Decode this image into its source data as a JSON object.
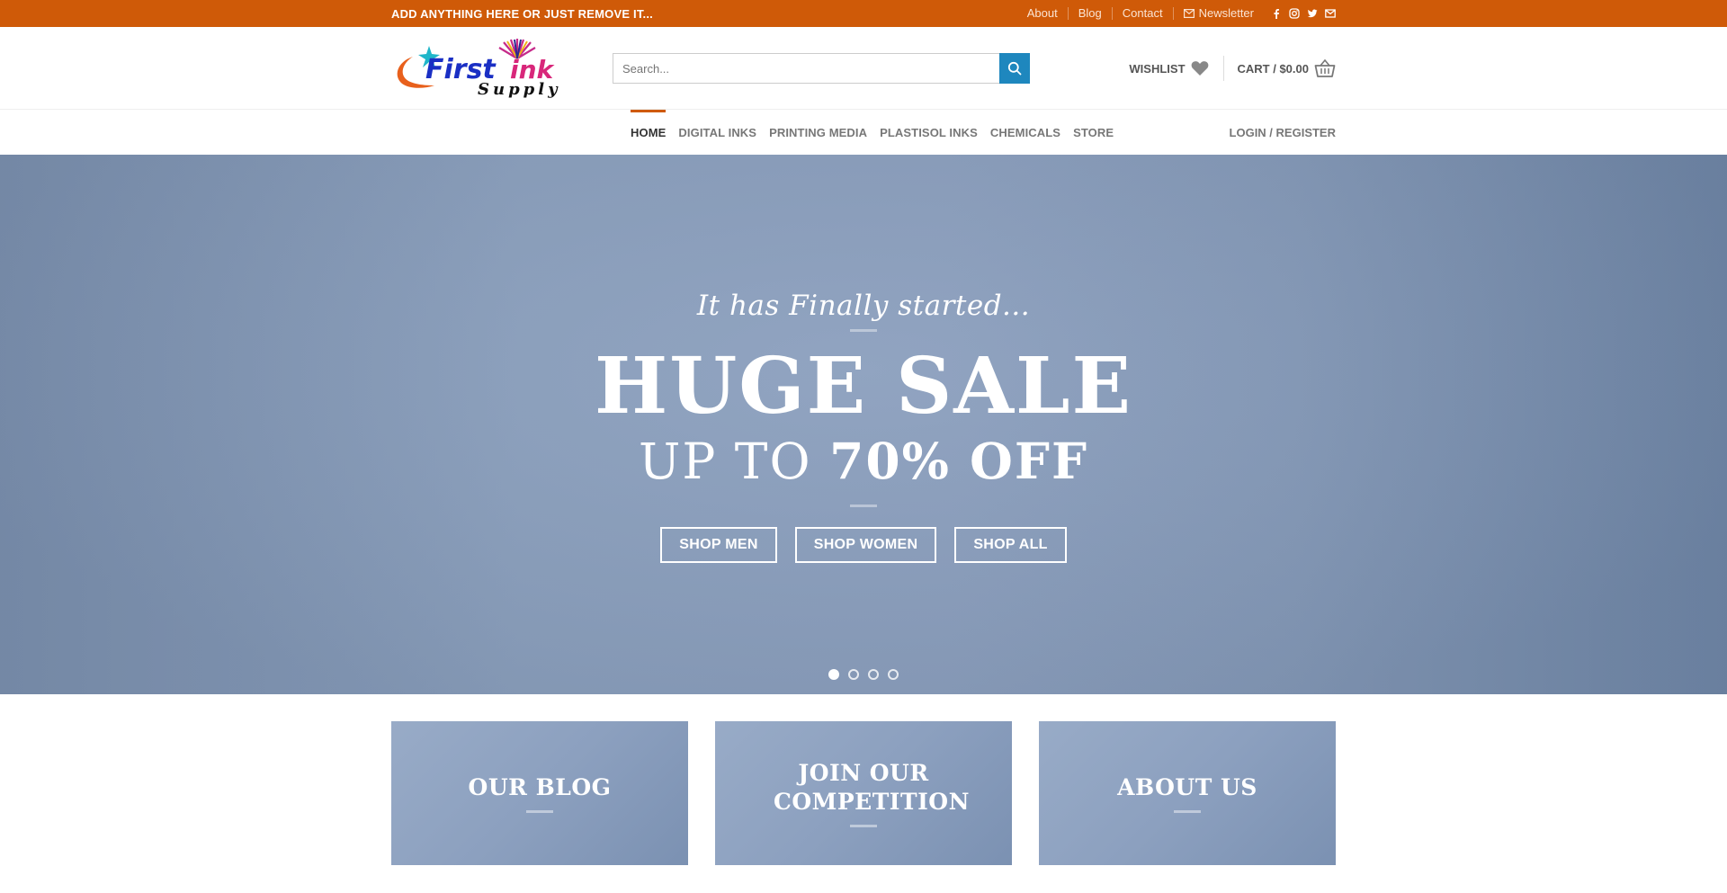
{
  "topbar": {
    "message": "ADD ANYTHING HERE OR JUST REMOVE IT...",
    "links": [
      "About",
      "Blog",
      "Contact"
    ],
    "newsletter": "Newsletter",
    "social_icons": [
      "facebook-icon",
      "instagram-icon",
      "twitter-icon",
      "email-icon"
    ],
    "background_color": "#cf5a08"
  },
  "header": {
    "logo": {
      "word1": "First",
      "word2": "ink",
      "tagline": "Supply"
    },
    "search": {
      "placeholder": "Search..."
    },
    "wishlist_label": "WISHLIST",
    "cart_label": "CART / $0.00",
    "accent_color": "#1e87be"
  },
  "nav": {
    "items": [
      "HOME",
      "DIGITAL INKS",
      "PRINTING MEDIA",
      "PLASTISOL INKS",
      "CHEMICALS",
      "STORE"
    ],
    "active": "HOME",
    "login": "LOGIN / REGISTER"
  },
  "hero": {
    "kicker": "It has Finally started...",
    "title": "HUGE SALE",
    "subtitle_prefix": "UP TO",
    "subtitle_bold": "70% OFF",
    "buttons": [
      "SHOP MEN",
      "SHOP WOMEN",
      "SHOP ALL"
    ],
    "slides": 4,
    "active_slide": 1
  },
  "promos": [
    {
      "title": "OUR BLOG"
    },
    {
      "title": "JOIN OUR COMPETITION"
    },
    {
      "title": "ABOUT US"
    }
  ]
}
